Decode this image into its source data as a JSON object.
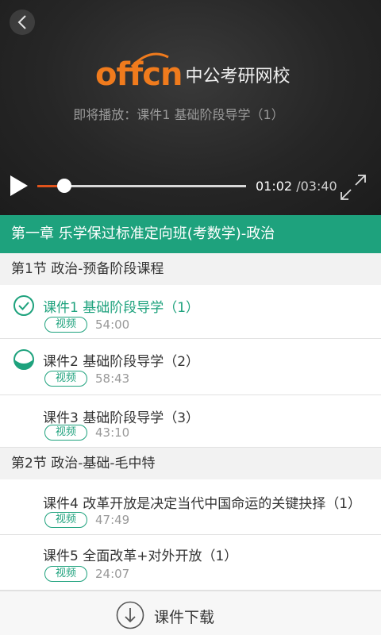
{
  "player": {
    "logo_word": "offcn",
    "logo_cn": "中公考研网校",
    "now_playing": "即将播放：课件1  基础阶段导学（1）",
    "current_time": "01:02",
    "total_time": " /03:40",
    "progress": 0.13
  },
  "chapter": {
    "title": "第一章 乐学保过标准定向班(考数学)-政治"
  },
  "sections": [
    {
      "title": "第1节 政治-预备阶段课程",
      "lessons": [
        {
          "title": "课件1 基础阶段导学（1）",
          "tag": "视频",
          "duration": "54:00",
          "status": "completed"
        },
        {
          "title": "课件2 基础阶段导学（2）",
          "tag": "视频",
          "duration": "58:43",
          "status": "half"
        },
        {
          "title": "课件3 基础阶段导学（3）",
          "tag": "视频",
          "duration": "43:10",
          "status": "none"
        }
      ]
    },
    {
      "title": "第2节 政治-基础-毛中特",
      "lessons": [
        {
          "title": "课件4 改革开放是决定当代中国命运的关键抉择（1）",
          "tag": "视频",
          "duration": "47:49",
          "status": "none"
        },
        {
          "title": "课件5 全面改革+对外开放（1）",
          "tag": "视频",
          "duration": "24:07",
          "status": "none"
        }
      ]
    }
  ],
  "download": {
    "label": "课件下载"
  },
  "colors": {
    "accent": "#1ea27d",
    "progress": "#e0531c",
    "logo": "#f07b1d"
  },
  "icons": {
    "back": "chevron-left-icon",
    "play": "play-icon",
    "fullscreen": "fullscreen-icon",
    "completed": "check-circle-icon",
    "half": "half-circle-icon",
    "download": "download-icon"
  }
}
